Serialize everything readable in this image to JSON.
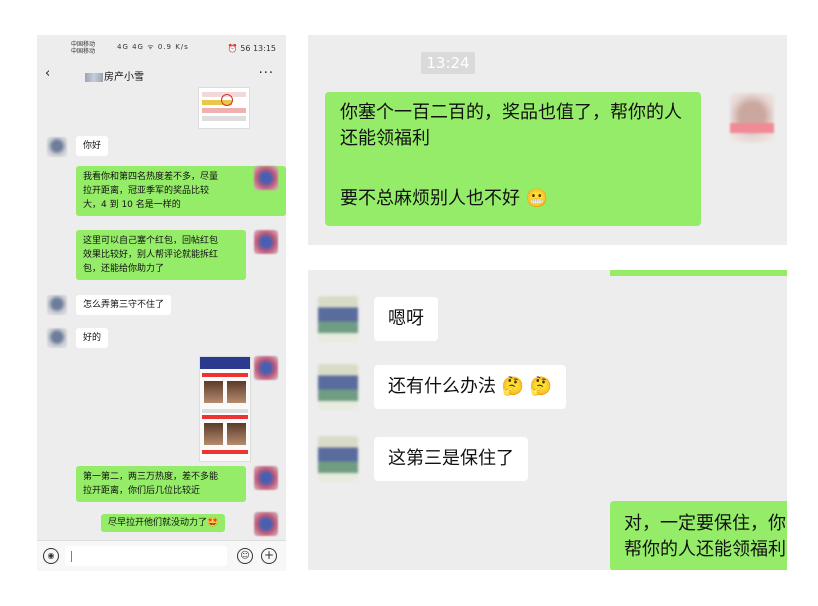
{
  "phone": {
    "status": {
      "carrier1": "中国移动",
      "carrier2": "中国移动",
      "signal_icons": "4G 4G ᯤ",
      "speed": "0.9 K/s",
      "right": "⏰ 56 13:15"
    },
    "nav": {
      "title": "房产小雪",
      "back_icon": "‹",
      "more_icon": "···"
    },
    "messages": {
      "m1": "你好",
      "m2_l1": "我看你和第四名热度差不多，尽量",
      "m2_l2": "拉开距离，冠亚季军的奖品比较",
      "m2_l3": "大，4 到 10 名是一样的",
      "m3_l1": "这里可以自己塞个红包，回帖红包",
      "m3_l2": "效果比较好，别人帮评论就能拆红",
      "m3_l3": "包，还能给你助力了",
      "m4": "怎么弄第三守不住了",
      "m5": "好的",
      "m6_l1": "第一第二，两三万热度，差不多能",
      "m6_l2": "拉开距离，你们后几位比较近",
      "m7": "尽早拉开他们就没动力了🤩"
    },
    "input": {
      "value": "",
      "voice_icon": "◉",
      "emoji_icon": "☺",
      "plus_icon": "+"
    }
  },
  "zoom1": {
    "time": "13:24",
    "line1": "你塞个一百二百的，奖品也值了，帮你的人",
    "line2": "还能领福利",
    "line3": "要不总麻烦别人也不好",
    "emoji": "😬"
  },
  "zoom2": {
    "msg1": "嗯呀",
    "msg2": "还有什么办法",
    "msg2_emoji": "🤔 🤔",
    "msg3": "这第三是保住了",
    "reply_l1": "对，一定要保住，你",
    "reply_l2": "帮你的人还能领福利"
  },
  "colors": {
    "green_bubble": "#95ec69",
    "chat_bg": "#ededed",
    "white_bubble": "#ffffff"
  }
}
